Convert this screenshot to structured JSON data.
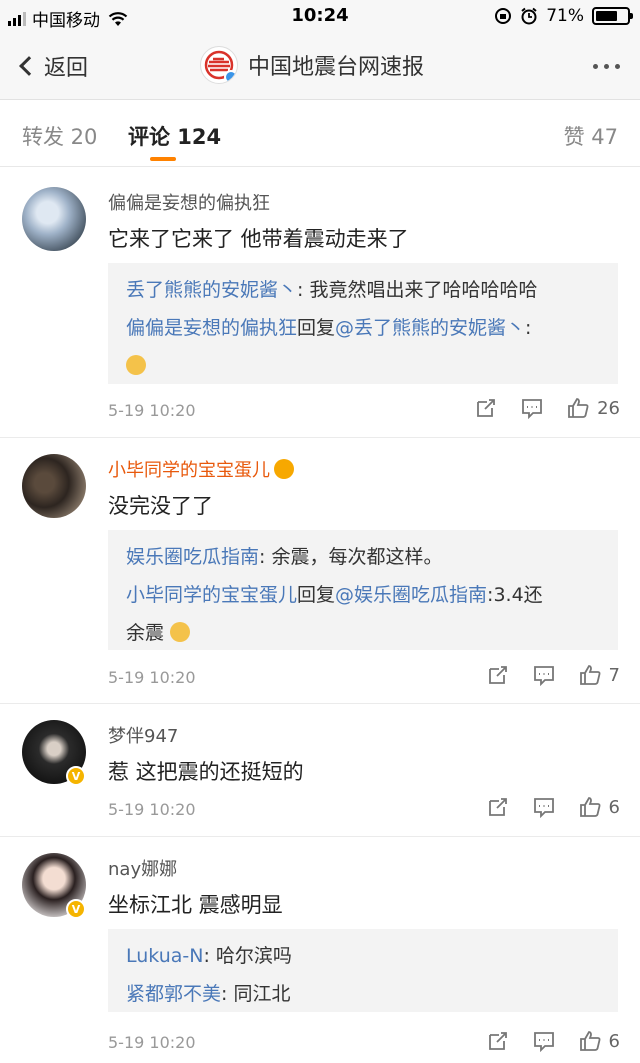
{
  "status_bar": {
    "carrier": "中国移动",
    "time": "10:24",
    "battery": "71%",
    "battery_level": 0.71
  },
  "nav": {
    "back_label": "返回",
    "title": "中国地震台网速报"
  },
  "tabs": {
    "repost": "转发 20",
    "comments": "评论 124",
    "likes": "赞 47"
  },
  "comments": [
    {
      "user": "偏偏是妄想的偏执狂",
      "text": "它来了它来了 他带着震动走来了",
      "reply_line1_user": "丢了熊熊的安妮酱丶",
      "reply_line1_text": ": 我竟然唱出来了哈哈哈哈哈",
      "reply_line2_user": "偏偏是妄想的偏执狂",
      "reply_line2_mid": "回复",
      "reply_line2_target": "@丢了熊熊的安妮酱丶",
      "reply_line2_text": ":",
      "time": "5-19 10:20",
      "likes": "26"
    },
    {
      "user": "小毕同学的宝宝蛋儿",
      "text": "没完没了了",
      "reply_line1_user": "娱乐圈吃瓜指南",
      "reply_line1_text": ": 余震，每次都这样。",
      "reply_line2_user": "小毕同学的宝宝蛋儿",
      "reply_line2_mid": "回复",
      "reply_line2_target": "@娱乐圈吃瓜指南",
      "reply_line2_text": ":3.4还",
      "reply_line3_text": "余震",
      "time": "5-19 10:20",
      "likes": "7"
    },
    {
      "user": "梦伴947",
      "text": "惹 这把震的还挺短的",
      "time": "5-19 10:20",
      "likes": "6"
    },
    {
      "user": "nay娜娜",
      "text": "坐标江北 震感明显",
      "reply_line1_user": "Lukua-N",
      "reply_line1_text": ": 哈尔滨吗",
      "reply_line2_user": "紧都郭不美",
      "reply_line2_text": ": 同江北",
      "time": "5-19 10:20",
      "likes": "6"
    }
  ],
  "colors": {
    "accent": "#ff8200",
    "link": "#4a78b8",
    "vip_name": "#e8590c"
  }
}
